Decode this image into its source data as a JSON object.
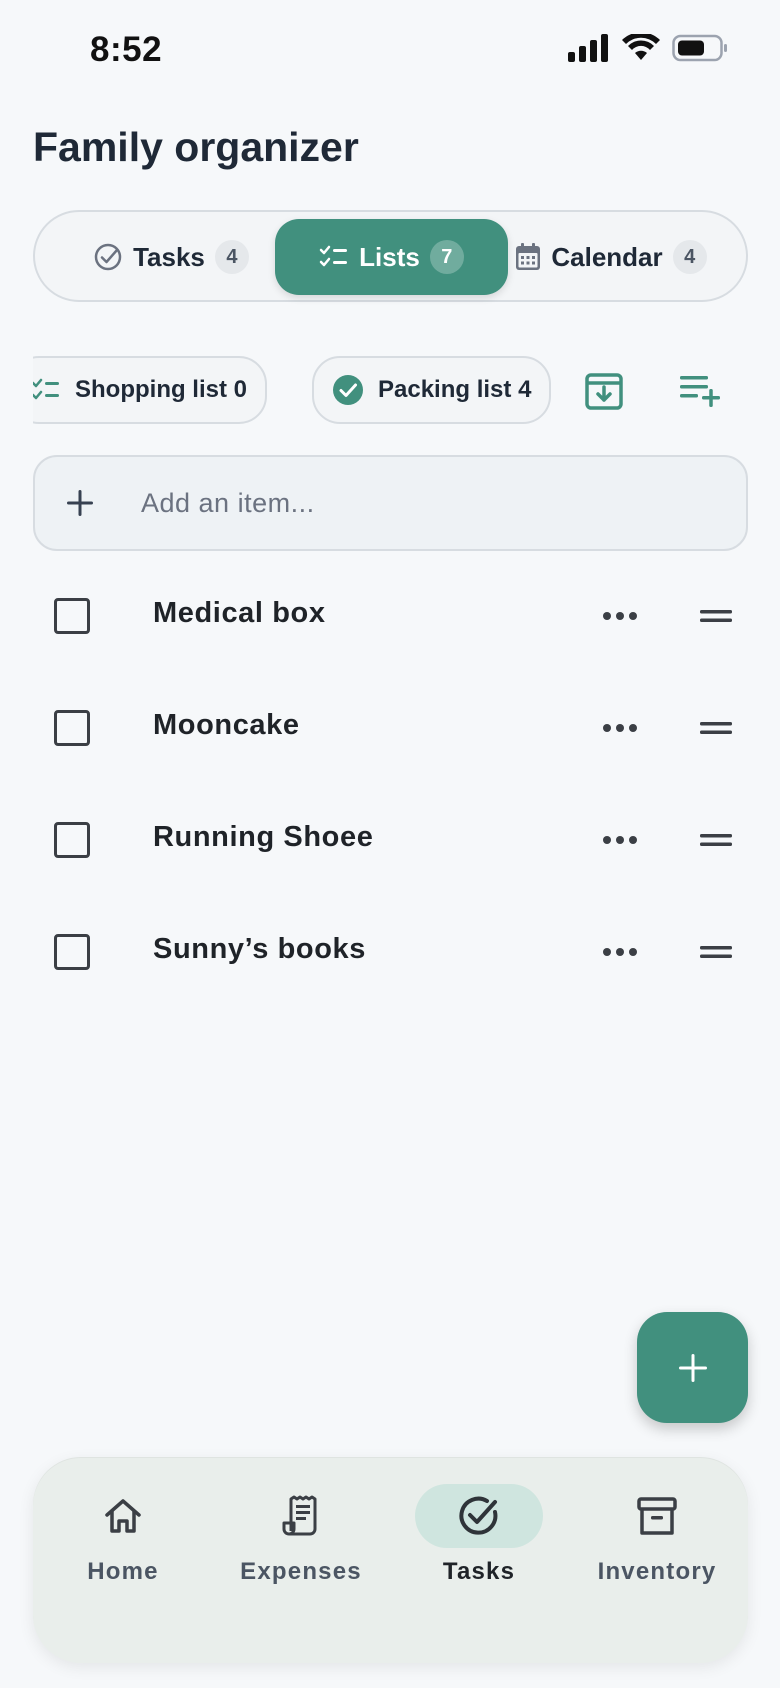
{
  "status": {
    "time": "8:52"
  },
  "header": {
    "title": "Family organizer"
  },
  "segments": [
    {
      "label": "Tasks",
      "count": "4",
      "icon": "check-circle-icon",
      "active": false
    },
    {
      "label": "Lists",
      "count": "7",
      "icon": "checklist-icon",
      "active": true
    },
    {
      "label": "Calendar",
      "count": "4",
      "icon": "calendar-icon",
      "active": false
    }
  ],
  "lists": {
    "chips": [
      {
        "label": "Shopping list",
        "count": "0",
        "icon": "checklist-icon"
      },
      {
        "label": "Packing list",
        "count": "4",
        "icon": "check-circle-filled-icon",
        "selected": true
      }
    ]
  },
  "add_item": {
    "placeholder": "Add an item..."
  },
  "items": [
    {
      "label": "Medical box",
      "checked": false
    },
    {
      "label": "Mooncake",
      "checked": false
    },
    {
      "label": "Running Shoee",
      "checked": false
    },
    {
      "label": "Sunny’s books",
      "checked": false
    }
  ],
  "nav": [
    {
      "label": "Home",
      "icon": "home-icon",
      "active": false
    },
    {
      "label": "Expenses",
      "icon": "receipt-icon",
      "active": false
    },
    {
      "label": "Tasks",
      "icon": "check-circle-icon",
      "active": true
    },
    {
      "label": "Inventory",
      "icon": "archive-box-icon",
      "active": false
    }
  ],
  "colors": {
    "accent": "#41907e",
    "background": "#f6f8fa",
    "nav_active_pill": "#cfe5df"
  }
}
